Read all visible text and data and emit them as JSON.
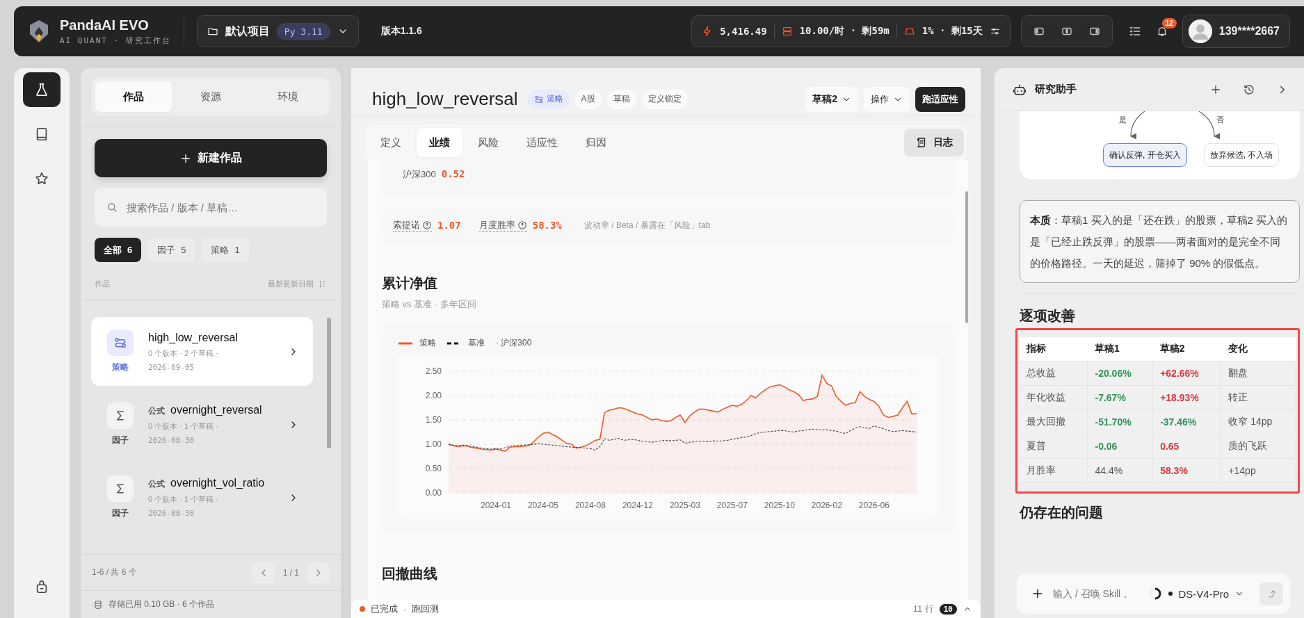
{
  "app": {
    "name": "PandaAI EVO",
    "tagline": "AI QUANT · 研究工作台"
  },
  "project": {
    "name": "默认项目",
    "runtime": "Py 3.11"
  },
  "version": "版本1.1.6",
  "stats": {
    "credits": "5,416.49",
    "compute": "10.00/时 · 剩59m",
    "storage": "1% · 剩15天"
  },
  "notifications": {
    "count": "12"
  },
  "user": {
    "name": "139****2667"
  },
  "rail": [
    {
      "kind": "flask",
      "selected": true
    },
    {
      "kind": "book",
      "selected": false
    },
    {
      "kind": "star",
      "selected": false
    }
  ],
  "sidebar": {
    "tabs": [
      {
        "label": "作品",
        "selected": true
      },
      {
        "label": "资源",
        "selected": false
      },
      {
        "label": "环境",
        "selected": false
      }
    ],
    "new_button": "新建作品",
    "search": {
      "placeholder": "搜索作品 / 版本 / 草稿…"
    },
    "filters": [
      {
        "label": "全部",
        "count": "6",
        "selected": true
      },
      {
        "label": "因子",
        "count": "5",
        "selected": false
      },
      {
        "label": "策略",
        "count": "1",
        "selected": false
      }
    ],
    "list_header": {
      "column_1": "作品",
      "sort": "最新更新日期"
    },
    "items": [
      {
        "kind": "strategy",
        "type_label": "策略",
        "name": "high_low_reversal",
        "meta": "0 个版本 · 2 个草稿 ·",
        "date": "2026-09-05",
        "selected": true
      },
      {
        "kind": "factor",
        "type_label": "因子",
        "prefix": "公式",
        "name": "overnight_reversal",
        "meta": "0 个版本 · 1 个草稿 ·",
        "date": "2026-08-30",
        "selected": false
      },
      {
        "kind": "factor",
        "type_label": "因子",
        "prefix": "公式",
        "name": "overnight_vol_ratio",
        "meta": "0 个版本 · 1 个草稿 ·",
        "date": "2026-08-30",
        "selected": false
      }
    ],
    "pagination": {
      "range": "1-6 / 共 6 个",
      "page": "1 / 1"
    },
    "storage": "存储已用 0.10 GB · 6 个作品"
  },
  "work": {
    "title": "high_low_reversal",
    "tags": [
      {
        "kind": "type",
        "label": "策略"
      },
      {
        "kind": "plain",
        "label": "A股"
      },
      {
        "kind": "plain",
        "label": "草稿"
      },
      {
        "kind": "plain",
        "label": "定义锁定"
      }
    ],
    "draft": "草稿2",
    "actions": "操作",
    "run_button": "跑适应性",
    "tabs": [
      {
        "label": "定义",
        "selected": false
      },
      {
        "label": "业绩",
        "selected": true
      },
      {
        "label": "风险",
        "selected": false
      },
      {
        "label": "适应性",
        "selected": false
      },
      {
        "label": "归因",
        "selected": false
      }
    ],
    "log_button": "日志",
    "benchmark": {
      "label": "沪深300",
      "value": "0.52"
    },
    "metrics": [
      {
        "label": "索提诺",
        "value": "1.07"
      },
      {
        "label": "月度胜率",
        "value": "58.3%"
      }
    ],
    "metrics_note": "波动率 / Beta / 暴露在「风险」tab",
    "nav_section": {
      "title": "累计净值",
      "subtitle": "策略 vs 基准 · 多年区间",
      "legend_note": "· 沪深300",
      "chart_data": {
        "type": "line",
        "grid": true,
        "categories": [
          null,
          null,
          null,
          null,
          null,
          null,
          null,
          null,
          null,
          null,
          "2024-01",
          null,
          null,
          null,
          null,
          null,
          null,
          null,
          null,
          null,
          "2024-05",
          null,
          null,
          null,
          null,
          null,
          null,
          null,
          null,
          null,
          "2024-08",
          null,
          null,
          null,
          null,
          null,
          null,
          null,
          null,
          null,
          "2024-12",
          null,
          null,
          null,
          null,
          null,
          null,
          null,
          null,
          null,
          "2025-03",
          null,
          null,
          null,
          null,
          null,
          null,
          null,
          null,
          null,
          "2025-07",
          null,
          null,
          null,
          null,
          null,
          null,
          null,
          null,
          null,
          "2025-10",
          null,
          null,
          null,
          null,
          null,
          null,
          null,
          null,
          null,
          "2026-02",
          null,
          null,
          null,
          null,
          null,
          null,
          null,
          null,
          null,
          "2026-06",
          null,
          null,
          null,
          null,
          null,
          null,
          null,
          null,
          null
        ],
        "ylim": [
          0,
          2.5
        ],
        "yticks": [
          {
            "value": 0,
            "label": "0.00"
          },
          {
            "value": 0.5,
            "label": "0.50"
          },
          {
            "value": 1,
            "label": "1.00"
          },
          {
            "value": 1.5,
            "label": "1.50"
          },
          {
            "value": 2,
            "label": "2.00"
          },
          {
            "value": 2.5,
            "label": "2.50"
          }
        ],
        "series": [
          {
            "name": "策略",
            "type": "area",
            "line_style": "solid",
            "color": "#f0592a",
            "values": [
              1.0,
              0.97,
              0.95,
              0.97,
              0.96,
              0.93,
              0.92,
              0.9,
              0.89,
              0.88,
              0.9,
              0.88,
              0.86,
              0.94,
              0.95,
              0.95,
              0.96,
              0.97,
              1.05,
              1.15,
              1.22,
              1.25,
              1.2,
              1.15,
              1.08,
              1.02,
              1.0,
              0.92,
              0.94,
              0.97,
              1.02,
              1.08,
              1.1,
              1.65,
              1.7,
              1.72,
              1.75,
              1.74,
              1.7,
              1.66,
              1.62,
              1.6,
              1.55,
              1.5,
              1.52,
              1.49,
              1.47,
              1.48,
              1.55,
              1.6,
              1.45,
              1.58,
              1.66,
              1.72,
              1.72,
              1.7,
              1.68,
              1.66,
              1.72,
              1.76,
              1.8,
              1.78,
              1.82,
              1.9,
              2.0,
              1.95,
              2.05,
              2.12,
              2.18,
              2.2,
              2.22,
              2.18,
              2.12,
              2.08,
              2.02,
              1.9,
              1.92,
              1.93,
              1.98,
              2.42,
              2.25,
              2.2,
              1.98,
              1.88,
              1.8,
              1.84,
              1.85,
              2.08,
              1.98,
              1.92,
              1.88,
              1.78,
              1.6,
              1.55,
              1.57,
              1.6,
              1.75,
              1.88,
              1.62,
              1.63
            ]
          },
          {
            "name": "基准",
            "type": "line",
            "line_style": "dashed",
            "color": "#444444",
            "values": [
              1.0,
              0.98,
              0.97,
              0.98,
              0.97,
              0.95,
              0.94,
              0.92,
              0.91,
              0.9,
              0.92,
              0.9,
              0.93,
              0.96,
              0.97,
              0.98,
              0.98,
              0.99,
              1.0,
              1.01,
              1.0,
              0.99,
              0.98,
              0.97,
              0.96,
              0.95,
              0.94,
              0.93,
              0.93,
              0.92,
              0.91,
              0.88,
              0.95,
              1.12,
              1.08,
              1.1,
              1.12,
              1.08,
              1.09,
              1.1,
              1.08,
              1.06,
              1.05,
              1.04,
              1.06,
              1.07,
              1.08,
              1.07,
              1.08,
              1.09,
              1.02,
              1.04,
              1.05,
              1.06,
              1.06,
              1.05,
              1.07,
              1.06,
              1.07,
              1.08,
              1.1,
              1.12,
              1.14,
              1.15,
              1.18,
              1.22,
              1.24,
              1.25,
              1.26,
              1.27,
              1.28,
              1.28,
              1.26,
              1.25,
              1.27,
              1.28,
              1.3,
              1.31,
              1.3,
              1.29,
              1.3,
              1.28,
              1.27,
              1.24,
              1.22,
              1.28,
              1.33,
              1.36,
              1.34,
              1.32,
              1.38,
              1.35,
              1.32,
              1.28,
              1.26,
              1.27,
              1.28,
              1.27,
              1.26,
              1.25
            ]
          }
        ]
      }
    },
    "drawdown_section": {
      "title": "回撤曲线"
    },
    "status_bar": {
      "state": "已完成",
      "separator": "·",
      "task": "跑回测",
      "rows": "11 行",
      "count": "10"
    }
  },
  "assistant": {
    "title": "研究助手",
    "flow": [
      {
        "label": "是",
        "node": "确认反弹, 开仓买入",
        "selected": true
      },
      {
        "label": "否",
        "node": "放弃候选, 不入场",
        "selected": false
      }
    ],
    "note": "**本质**：草稿1 买入的是「还在跌」的股票，草稿2 买入的是「已经止跌反弹」的股票——两者面对的是完全不同的价格路径。一天的延迟，筛掉了 90% 的假低点。",
    "section_title": "逐项改善",
    "table": {
      "columns": [
        "指标",
        "草稿1",
        "草稿2",
        "变化"
      ],
      "rows": [
        [
          {
            "text": "总收益"
          },
          {
            "text": "-20.06%",
            "color": "#2e9456"
          },
          {
            "text": "+62.66%",
            "color": "#d9363e"
          },
          {
            "text": "翻盘"
          }
        ],
        [
          {
            "text": "年化收益"
          },
          {
            "text": "-7.67%",
            "color": "#2e9456"
          },
          {
            "text": "+18.93%",
            "color": "#d9363e"
          },
          {
            "text": "转正"
          }
        ],
        [
          {
            "text": "最大回撤"
          },
          {
            "text": "-51.70%",
            "color": "#2e9456"
          },
          {
            "text": "-37.46%",
            "color": "#2e9456"
          },
          {
            "text": "收窄 14pp"
          }
        ],
        [
          {
            "text": "夏普"
          },
          {
            "text": "-0.06",
            "color": "#2e9456"
          },
          {
            "text": "0.65",
            "color": "#d9363e"
          },
          {
            "text": "质的飞跃"
          }
        ],
        [
          {
            "text": "月胜率"
          },
          {
            "text": "44.4%"
          },
          {
            "text": "58.3%",
            "color": "#d9363e"
          },
          {
            "text": "+14pp"
          }
        ]
      ]
    },
    "next_section": "仍存在的问题",
    "input": {
      "placeholder": "输入 / 召唤 Skill，",
      "model": "DS-V4-Pro"
    }
  }
}
